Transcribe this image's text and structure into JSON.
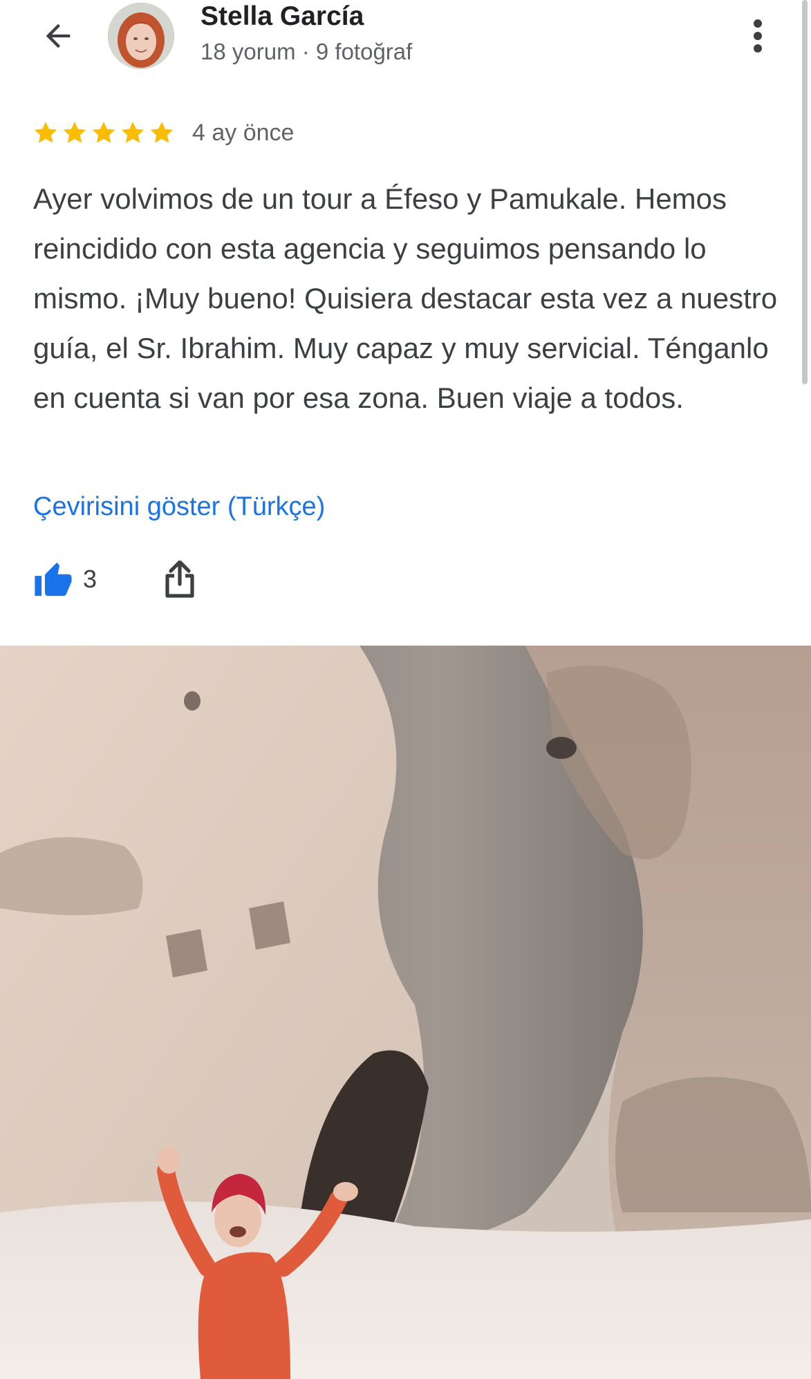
{
  "header": {
    "back_icon": "arrow-left-icon",
    "author_name": "Stella García",
    "author_meta": "18 yorum · 9 fotoğraf",
    "more_icon": "more-vertical-icon"
  },
  "review": {
    "rating": 5,
    "max_rating": 5,
    "star_color": "#fbbc04",
    "date": "4 ay önce",
    "text": "Ayer volvimos de un tour a Éfeso y Pamukale. Hemos reincidido con esta agencia y seguimos pensando lo mismo. ¡Muy bueno! Quisiera destacar esta vez a nuestro guía, el Sr. Ibrahim. Muy capaz y muy servicial. Ténganlo en cuenta si van por esa zona. Buen viaje a todos.",
    "translate_label": "Çevirisini göster (Türkçe)",
    "link_color": "#1a73e8"
  },
  "actions": {
    "like_icon": "thumbs-up-icon",
    "like_count": "3",
    "like_color": "#1a73e8",
    "share_icon": "share-icon"
  },
  "photo": {
    "subject": "review-photo"
  }
}
